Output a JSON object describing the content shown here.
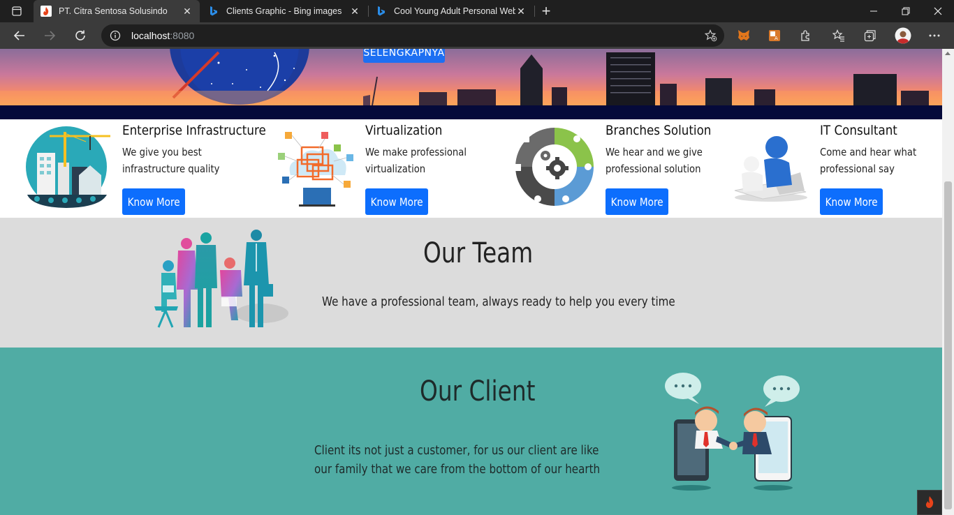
{
  "browser": {
    "tabs": [
      {
        "title": "PT. Citra Sentosa Solusindo",
        "active": true,
        "icon": "flame-icon"
      },
      {
        "title": "Clients Graphic - Bing images",
        "active": false,
        "icon": "bing-icon"
      },
      {
        "title": "Cool Young Adult Personal Webs",
        "active": false,
        "icon": "bing-icon"
      }
    ],
    "address": {
      "host": "localhost",
      "port": ":8080"
    }
  },
  "hero": {
    "button_label": "SELENGKAPNYA"
  },
  "services": [
    {
      "title": "Enterprise Infrastructure",
      "desc": "We give you best infrastructure quality",
      "button": "Know More",
      "icon": "infrastructure-illustration"
    },
    {
      "title": "Virtualization",
      "desc": "We make professional virtualization",
      "button": "Know More",
      "icon": "cloud-virtualization-illustration"
    },
    {
      "title": "Branches Solution",
      "desc": "We hear and we give professional solution",
      "button": "Know More",
      "icon": "gears-illustration"
    },
    {
      "title": "IT Consultant",
      "desc": "Come and hear what professional say",
      "button": "Know More",
      "icon": "consultant-illustration"
    }
  ],
  "team": {
    "title": "Our Team",
    "text": "We have a professional team, always ready to help you every time"
  },
  "client": {
    "title": "Our Client",
    "text": "Client its not just a customer, for us our client are like our family that we care from the bottom of our hearth"
  },
  "colors": {
    "primary_button": "#0d6efd",
    "team_bg": "#dcdcdc",
    "client_bg": "#50aca4",
    "strip": "#050a3a"
  }
}
